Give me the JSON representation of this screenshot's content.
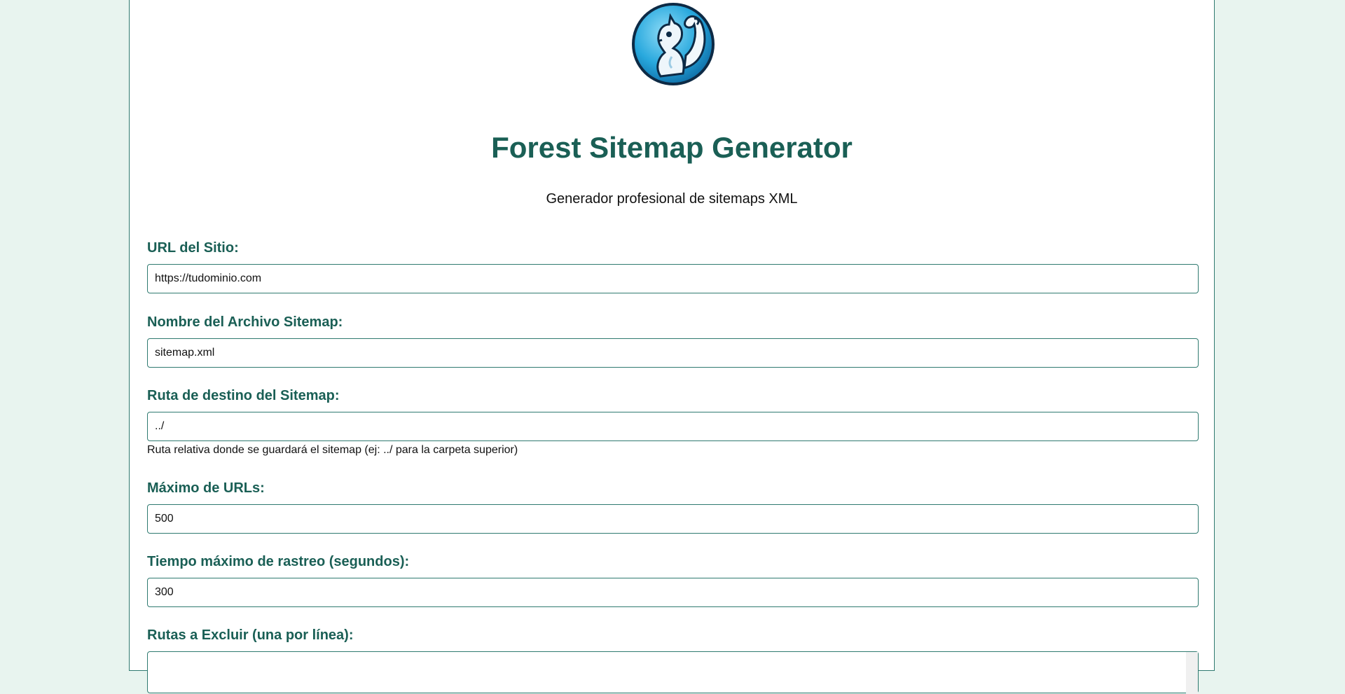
{
  "header": {
    "logo_icon": "squirrel-logo-icon",
    "title": "Forest Sitemap Generator",
    "subtitle": "Generador profesional de sitemaps XML"
  },
  "form": {
    "site_url": {
      "label": "URL del Sitio:",
      "value": "https://tudominio.com"
    },
    "sitemap_filename": {
      "label": "Nombre del Archivo Sitemap:",
      "value": "sitemap.xml"
    },
    "sitemap_path": {
      "label": "Ruta de destino del Sitemap:",
      "value": "../",
      "help": "Ruta relativa donde se guardará el sitemap (ej: ../ para la carpeta superior)"
    },
    "max_urls": {
      "label": "Máximo de URLs:",
      "value": "500"
    },
    "max_time": {
      "label": "Tiempo máximo de rastreo (segundos):",
      "value": "300"
    },
    "exclude_paths": {
      "label": "Rutas a Excluir (una por línea):"
    }
  },
  "colors": {
    "page_background": "#e8f4ef",
    "accent": "#1a5f55",
    "border": "#2f7a70",
    "logo_blue": "#1e9bd7"
  }
}
